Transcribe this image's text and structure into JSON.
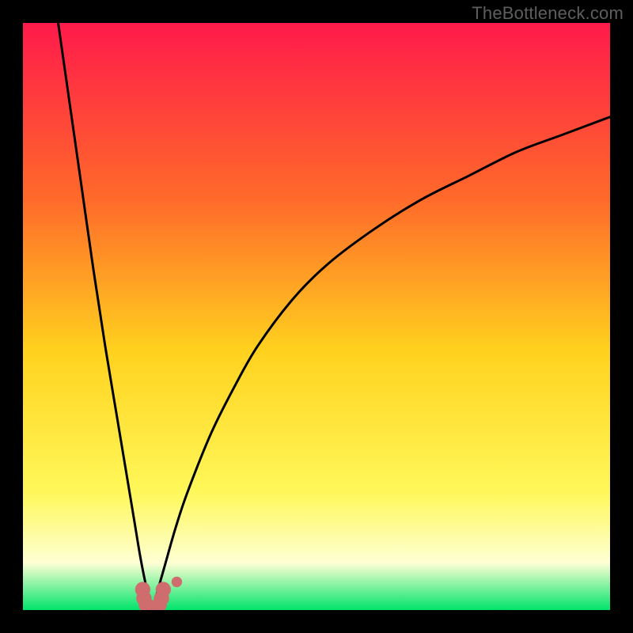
{
  "watermark": "TheBottleneck.com",
  "colors": {
    "frame": "#000000",
    "curve": "#000000",
    "markers": "#cf6d6e",
    "gradient_top": "#ff1a4b",
    "gradient_mid_upper": "#ff6a2a",
    "gradient_mid": "#ffd21e",
    "gradient_mid_lower": "#fff85a",
    "gradient_pale": "#feffd4",
    "gradient_bottom": "#00e46a"
  },
  "chart_data": {
    "type": "line",
    "title": "",
    "xlabel": "",
    "ylabel": "",
    "xlim": [
      0,
      100
    ],
    "ylim": [
      0,
      100
    ],
    "legend": false,
    "grid": false,
    "series": [
      {
        "name": "left-branch",
        "comment": "Steep descending curve entering from top-left and dropping to the trough near x≈21.",
        "x": [
          6,
          8,
          10,
          12,
          14,
          16,
          18,
          19,
          20,
          21,
          22
        ],
        "y": [
          100,
          86,
          72,
          58,
          45,
          33,
          21,
          15,
          9,
          4,
          0
        ]
      },
      {
        "name": "right-branch",
        "comment": "Slowly rising concave curve from the trough toward the upper-right, ending near y≈84 at the right edge.",
        "x": [
          22,
          24,
          26,
          28,
          32,
          36,
          40,
          46,
          52,
          60,
          68,
          76,
          84,
          92,
          100
        ],
        "y": [
          0,
          7,
          14,
          20,
          30,
          38,
          45,
          53,
          59,
          65,
          70,
          74,
          78,
          81,
          84
        ]
      }
    ],
    "markers": {
      "comment": "Cluster of salmon/pink round markers at the trough (~x 21–24, y 0–5), plus one small dot slightly above/right.",
      "points": [
        {
          "x": 20.4,
          "y": 3.5,
          "r": 1.3
        },
        {
          "x": 20.6,
          "y": 2.0,
          "r": 1.3
        },
        {
          "x": 21.0,
          "y": 0.9,
          "r": 1.3
        },
        {
          "x": 21.8,
          "y": 0.3,
          "r": 1.3
        },
        {
          "x": 22.6,
          "y": 0.3,
          "r": 1.3
        },
        {
          "x": 23.2,
          "y": 0.9,
          "r": 1.3
        },
        {
          "x": 23.6,
          "y": 2.0,
          "r": 1.3
        },
        {
          "x": 23.9,
          "y": 3.5,
          "r": 1.3
        },
        {
          "x": 26.2,
          "y": 4.8,
          "r": 0.9
        }
      ]
    }
  }
}
